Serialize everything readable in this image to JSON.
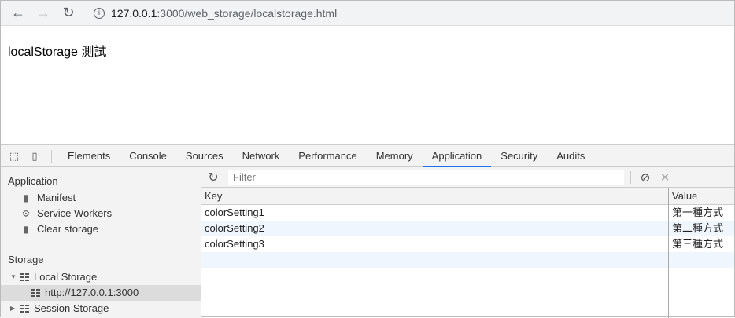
{
  "browser": {
    "url_host": "127.0.0.1",
    "url_path": ":3000/web_storage/localstorage.html"
  },
  "page": {
    "heading": "localStorage 測試"
  },
  "devtools": {
    "tabs": [
      "Elements",
      "Console",
      "Sources",
      "Network",
      "Performance",
      "Memory",
      "Application",
      "Security",
      "Audits"
    ],
    "active_tab": "Application",
    "sidebar": {
      "application_header": "Application",
      "application_items": [
        "Manifest",
        "Service Workers",
        "Clear storage"
      ],
      "storage_header": "Storage",
      "local_storage": "Local Storage",
      "local_storage_origin": "http://127.0.0.1:3000",
      "session_storage": "Session Storage"
    },
    "filter_placeholder": "Filter",
    "table": {
      "columns": [
        "Key",
        "Value"
      ],
      "rows": [
        {
          "key": "colorSetting1",
          "value": "第一種方式"
        },
        {
          "key": "colorSetting2",
          "value": "第二種方式"
        },
        {
          "key": "colorSetting3",
          "value": "第三種方式"
        }
      ]
    }
  }
}
